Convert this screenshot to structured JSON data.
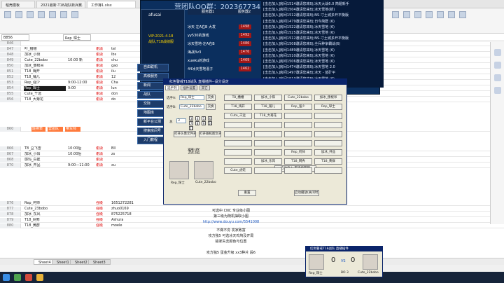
{
  "browser_tabs": [
    "稻壳模板",
    "2021最新-T18战队新兵赛...",
    "工作簿1.xlsx"
  ],
  "formula_bar": {
    "name_box": "B856",
    "formula": "Rep_琛士"
  },
  "sheet": {
    "rows_top": [
      {
        "rn": "846",
        "a": "",
        "b": "",
        "c": "",
        "d": ""
      },
      {
        "rn": "847",
        "a": "叶_槽槽",
        "b": "",
        "c": "谢潇",
        "d": "tel"
      },
      {
        "rn": "848",
        "a": "加冰_小阳",
        "b": "",
        "c": "谢潇",
        "d": "lbs"
      },
      {
        "rn": "849",
        "a": "Cute_22bobo",
        "b": "10:00  新",
        "c": "谢潇",
        "d": "chu"
      },
      {
        "rn": "850",
        "a": "加冰_傻根吊",
        "b": "",
        "c": "谢潇",
        "d": "gao"
      },
      {
        "rn": "851",
        "a": "T18_嗨开",
        "b": "",
        "c": "谢潇",
        "d": "ilu"
      },
      {
        "rn": "852",
        "a": "T18_铺儿",
        "b": "",
        "c": "谢潇",
        "d": "12"
      },
      {
        "rn": "853",
        "a": "Rep_强少",
        "b": "9:00-12:00",
        "c": "谢潇",
        "d": "Cha"
      },
      {
        "rn": "854",
        "a": "Rep_琛士",
        "b": "9:00",
        "c": "谢潇",
        "d": "lun"
      },
      {
        "rn": "855",
        "a": "Cute_千远",
        "b": "",
        "c": "谢潇",
        "d": "don"
      },
      {
        "rn": "856",
        "a": "T18_大菊花",
        "b": "",
        "c": "谢潇",
        "d": "do"
      }
    ],
    "section_header": {
      "rn": "860",
      "a": "班排表",
      "b": "营团队",
      "c": "带军师"
    },
    "rows_mid": [
      {
        "rn": "866",
        "a": "T8_豆飞雪",
        "b": "10:00后",
        "c": "谢潇",
        "d": "Bll"
      },
      {
        "rn": "867",
        "a": "加冰_小阳",
        "b": "10:00后",
        "c": "谢潇",
        "d": "zs"
      },
      {
        "rn": "868",
        "a": "感玛_白崔",
        "b": "",
        "c": "谢潇",
        "d": ""
      },
      {
        "rn": "870",
        "a": "加冰_开品",
        "b": "9:00—11:00",
        "c": "谢潇",
        "d": "xu"
      }
    ],
    "rows_bot": [
      {
        "rn": "876",
        "a": "Rep_何帅",
        "b": "",
        "c": "强级",
        "d": "1651272281"
      },
      {
        "rn": "877",
        "a": "Cute_23bobo",
        "b": "",
        "c": "强级",
        "d": "zhuo0169"
      },
      {
        "rn": "878",
        "a": "加冰_东风",
        "b": "",
        "c": "强级",
        "d": "875225718"
      },
      {
        "rn": "879",
        "a": "T18_网秀",
        "b": "",
        "c": "强级",
        "d": "Ashura"
      },
      {
        "rn": "880",
        "a": "T18_黄群",
        "b": "",
        "c": "强级",
        "d": "moele"
      }
    ],
    "notes": [
      "可选中 CNC 专业级小图",
      "第三级为随机抽取小图",
      "http://www.douyu.com/5541008",
      "不做不夯 发家致富",
      "攻方独5 可选冰天鸡鸠及开局",
      "输家失去颜色与位置",
      "攻方独5 蛋金升级 xx3种片 段6"
    ]
  },
  "sheet_tabs": [
    "Sheet4",
    "Sheet1",
    "Sheet2",
    "Sheet3"
  ],
  "banner": {
    "text": "营团队QQ群：202367734  T18战队新兵QQ群：1993191",
    "brand": "afusai",
    "vip": "VIP:2021-4-18",
    "team": "战队,T18战绩服",
    "server_tab1": "服务器1",
    "server_tab2": "服务器2",
    "servers": [
      {
        "name": "冰天  左A右B  大发",
        "num": "1498"
      },
      {
        "name": "yy530的游戏",
        "num": "1492"
      },
      {
        "name": "冰天雪地-左A右B",
        "num": "1486"
      },
      {
        "name": "海战3v3",
        "num": "1476"
      },
      {
        "name": "xuwku的游戏",
        "num": "1469"
      },
      {
        "name": "44冰天雪地混子",
        "num": "1462"
      }
    ],
    "menu": [
      "自由联机",
      "高级服务",
      "新闻",
      "战队",
      "交际",
      "地图库",
      "新平台公测",
      "搜索房间号",
      "入门教程"
    ]
  },
  "announcements": [
    "[击击加入]房间1514邀请您来玩:冰天大战6.0 简题新手",
    "[击击加入]房间1504邀请您来玩:冰天雪地(新)",
    "[击击加入]房间1512邀请您来玩:NS-寸土城多开平衡版",
    "[击击加入]房间1479邀请您来玩:日今简群 (6)",
    "[击击加入]房间1522邀请您来玩:冰天雪地 (6)",
    "[击击加入]房间1525邀请您来玩:冰天雪地 (6)",
    "[击击加入]房间1512邀请您来玩:NS-寸土城多开平衡版",
    "[击击加入]房间1508邀请您来玩:全兵种争霸战(6)",
    "[击击加入]房间1489邀请您来玩:冰天雪地 (6)",
    "[击击加入]房间1510邀请您来玩:冰天雪地 (6)",
    "[击击加入]房间1506邀请您来玩:冰天雪地 (6)",
    "[击击加入]房间1474邀请您来玩:冰天雪地 2.0",
    "[击击加入]房间1497邀请您来玩:冰天 - 蓝矿平",
    "[击击加入]房间1513邀请您来玩:冰天雪地 (6)",
    "[击击加入]房间1516邀请您来玩:简单射(风)V6"
  ],
  "dialog": {
    "title": "红色警戒T18战队 直播插件--设分设定",
    "tabs": [
      "选手列",
      "插件设置",
      "其它"
    ],
    "player_a_label": "选手A:",
    "player_a_value": "Rep_琛士",
    "player_b_label": "选手B:",
    "player_b_value": "Cute_22bobo",
    "swap": "交换",
    "score_label": "总",
    "score_value": "3",
    "score_opts": [
      "3",
      "4",
      "5",
      "6",
      "7",
      "8",
      "9",
      "10",
      "11"
    ],
    "open_folder": "打开头像文件夹",
    "open_random": "打开随机图文夹",
    "preview": "预览",
    "avatar_a": "Rep_琛士",
    "avatar_b": "Cute_22bobo",
    "reset_btn": "重置",
    "confirm_btn": "启动播放(关闭时)",
    "status_btn": "启动启入 不连续节目",
    "players": [
      [
        "T8_槽槽",
        "加冰_小阳",
        "Cute_22bobo",
        "加冰_傻根吊"
      ],
      [
        "T18_嗨开",
        "T18_铺儿",
        "Rep_强少",
        "Rep_琛士"
      ],
      [
        "Cute_千远",
        "T18_大菊花",
        "",
        ""
      ],
      [
        "",
        "",
        "",
        ""
      ],
      [
        "",
        "",
        "",
        ""
      ],
      [
        "",
        "",
        "",
        ""
      ],
      [
        "",
        "",
        "Rep_何帅",
        "加冰_开品"
      ],
      [
        "",
        "加冰_东风",
        "T18_网秀",
        "T18_黄群"
      ],
      [
        "Cute_虎蛇",
        "",
        "",
        ""
      ]
    ]
  },
  "mini": {
    "title": "红色警戒T18战队 直播插件",
    "left_name": "Rep_琛士",
    "right_name": "Cute_22bobo",
    "score_left": "0",
    "vs": "VS",
    "score_right": "0",
    "round": "BO 3"
  }
}
